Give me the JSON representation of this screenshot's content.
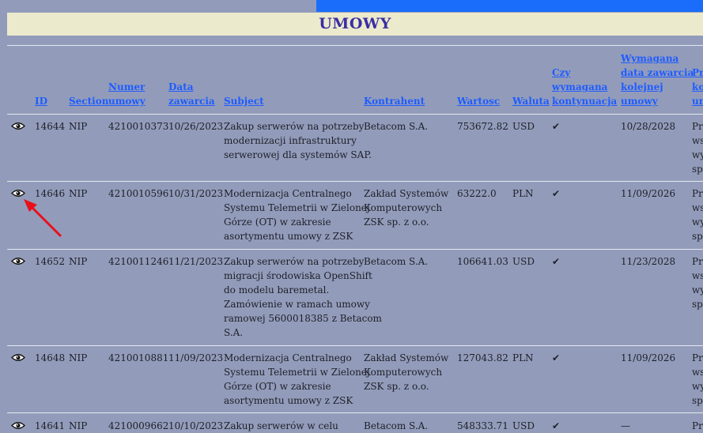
{
  "page": {
    "title": "UMOWY"
  },
  "columns": [
    "ID",
    "Section",
    "Numer umowy",
    "Data zawarcia",
    "Subject",
    "Kontrahent",
    "Wartosc",
    "Waluta",
    "Czy wymagana kontynuacja",
    "Wymagana data zawarcia kolejnej umowy",
    "Prz kol um"
  ],
  "rows": [
    {
      "id": "14644",
      "section": "NIP",
      "numer": "4210010373",
      "data": "10/26/2023",
      "subject": [
        "Zakup serwerów na potrzeby",
        "modernizacji infrastruktury",
        "serwerowej dla systemów SAP."
      ],
      "kontrahent": [
        "Betacom S.A."
      ],
      "wartosc": "753672.82",
      "waluta": "USD",
      "kontynuacja": "✔",
      "wymagana": "10/28/2028",
      "last": [
        "Prz",
        "ws",
        "wy",
        "spr"
      ]
    },
    {
      "id": "14646",
      "section": "NIP",
      "numer": "4210010596",
      "data": "10/31/2023",
      "subject": [
        "Modernizacja Centralnego",
        "Systemu Telemetrii w Zielonej",
        "Górze (OT) w zakresie",
        "asortymentu umowy z ZSK"
      ],
      "kontrahent": [
        "Zakład Systemów",
        "Komputerowych",
        "ZSK sp. z o.o."
      ],
      "wartosc": "63222.0",
      "waluta": "PLN",
      "kontynuacja": "✔",
      "wymagana": "11/09/2026",
      "last": [
        "Prz",
        "ws",
        "wy",
        "spr"
      ]
    },
    {
      "id": "14652",
      "section": "NIP",
      "numer": "4210011246",
      "data": "11/21/2023",
      "subject": [
        "Zakup serwerów na potrzeby",
        "migracji środowiska OpenShift",
        "do modelu baremetal.",
        "Zamówienie w ramach umowy",
        "ramowej 5600018385 z Betacom",
        "S.A."
      ],
      "kontrahent": [
        "Betacom S.A."
      ],
      "wartosc": "106641.03",
      "waluta": "USD",
      "kontynuacja": "✔",
      "wymagana": "11/23/2028",
      "last": [
        "Prz",
        "ws",
        "wy",
        "spr"
      ]
    },
    {
      "id": "14648",
      "section": "NIP",
      "numer": "4210010881",
      "data": "11/09/2023",
      "subject": [
        "Modernizacja Centralnego",
        "Systemu Telemetrii w Zielonej",
        "Górze (OT) w zakresie",
        "asortymentu umowy z ZSK"
      ],
      "kontrahent": [
        "Zakład Systemów",
        "Komputerowych",
        "ZSK sp. z o.o."
      ],
      "wartosc": "127043.82",
      "waluta": "PLN",
      "kontynuacja": "✔",
      "wymagana": "11/09/2026",
      "last": [
        "Prz",
        "ws",
        "wy",
        "spr"
      ]
    },
    {
      "id": "14641",
      "section": "NIP",
      "numer": "4210009662",
      "data": "10/10/2023",
      "subject": [
        "Zakup serwerów w celu"
      ],
      "kontrahent": [
        "Betacom S.A."
      ],
      "wartosc": "548333.71",
      "waluta": "USD",
      "kontynuacja": "✔",
      "wymagana": "—",
      "last": [
        "Prz"
      ]
    }
  ]
}
